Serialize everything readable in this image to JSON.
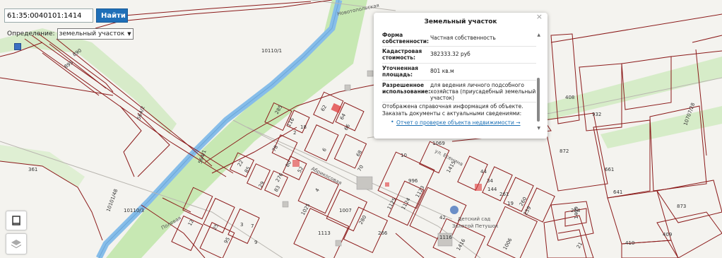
{
  "search": {
    "value": "61:35:0040101:1414",
    "button_label": "Найти"
  },
  "definition": {
    "label": "Определение:",
    "selected": "земельный участок"
  },
  "popup": {
    "title": "Земельный участок",
    "close": "×",
    "rows": [
      {
        "key": "Форма собственности:",
        "value": "Частная собственность"
      },
      {
        "key": "Кадастровая стоимость:",
        "value": "382333.32 руб"
      },
      {
        "key": "Уточненная площадь:",
        "value": "801 кв.м"
      },
      {
        "key": "Разрешенное использование:",
        "value": "для ведения личного подсобного хозяйства (приусадебный земельный участок)"
      }
    ],
    "info_line1": "Отображена справочная информация об объекте.",
    "info_line2": "Заказать документы с актуальными сведениями:",
    "link": "Отчет о проверке объекта недвижимости →"
  },
  "map": {
    "colors": {
      "boundary": "#8b1a1a",
      "river": "#7fb6e8",
      "green": "#bfe3a8",
      "highlight": "#e03a3a"
    },
    "streets": [
      "Абрикосовая",
      "ул. Есенина",
      "Новотопольская",
      "Полевая"
    ],
    "kindergarten": [
      "Детский сад",
      "Золотой Петушок"
    ],
    "plot_labels": [
      "890",
      "895",
      "10110/1",
      "564/2",
      "564/1",
      "361",
      "10101/48",
      "10110/3",
      "285",
      "62",
      "64",
      "66",
      "68",
      "6",
      "22",
      "78",
      "80",
      "52",
      "85",
      "29",
      "83",
      "276",
      "4",
      "70",
      "1025",
      "1007",
      "1113",
      "266",
      "280",
      "1125",
      "1124",
      "1123",
      "996",
      "1069",
      "44",
      "34",
      "144",
      "261",
      "260",
      "259",
      "254",
      "1409",
      "408",
      "932",
      "872",
      "661",
      "641",
      "873",
      "409",
      "410",
      "10707/28",
      "1006",
      "1416",
      "21",
      "25",
      "12",
      "95",
      "42",
      "1116",
      "1415",
      "116",
      "18",
      "2",
      "3",
      "7",
      "9",
      "10",
      "19",
      "23"
    ]
  }
}
